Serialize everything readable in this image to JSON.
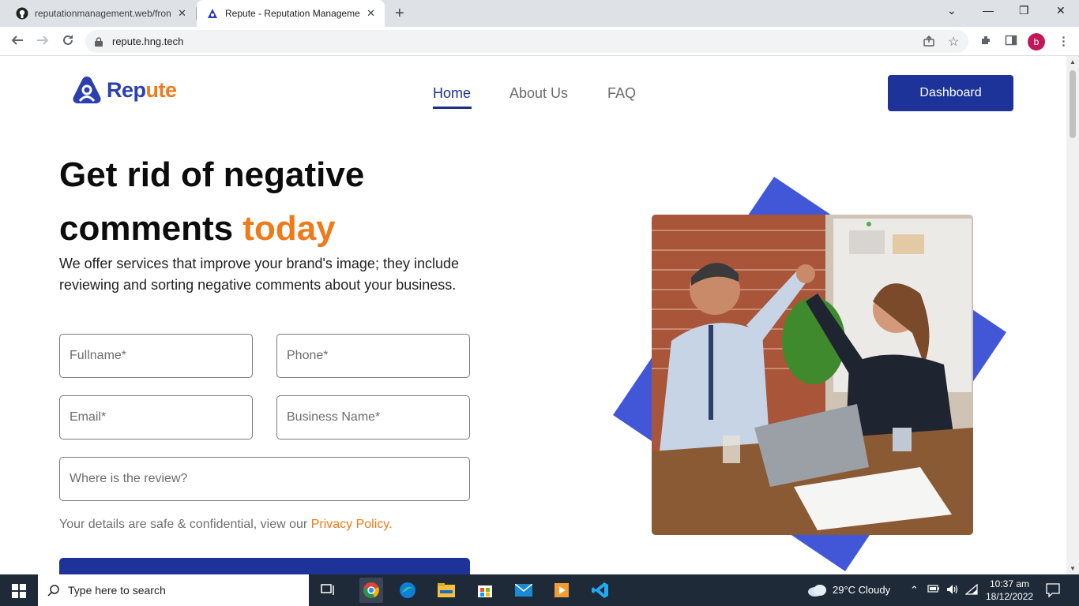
{
  "browser": {
    "tabs": [
      {
        "title": "reputationmanagement.web/fron",
        "close": "✕"
      },
      {
        "title": "Repute - Reputation Manageme",
        "close": "✕"
      }
    ],
    "new_tab": "+",
    "url": "repute.hng.tech",
    "profile_initial": "b",
    "window_controls": {
      "chevron": "⌄",
      "minimize": "—",
      "maximize": "❐",
      "close": "✕"
    }
  },
  "site": {
    "logo": {
      "part1": "Rep",
      "part2": "ute"
    },
    "nav": [
      {
        "label": "Home",
        "active": true
      },
      {
        "label": "About Us",
        "active": false
      },
      {
        "label": "FAQ",
        "active": false
      }
    ],
    "dashboard_label": "Dashboard",
    "hero": {
      "line1": "Get rid of negative",
      "line2_a": "comments ",
      "line2_b": "today",
      "subtitle": "We offer services that improve your brand's image; they include reviewing and sorting negative comments about your business."
    },
    "form": {
      "fullname": "Fullname*",
      "phone": "Phone*",
      "email": "Email*",
      "business": "Business Name*",
      "review": "Where is the review?"
    },
    "privacy": {
      "text": "Your details are safe & confidential, view our ",
      "link": "Privacy Policy."
    },
    "colors": {
      "primary": "#1d3399",
      "accent": "#ef7a1a",
      "diamond": "#4257d8"
    }
  },
  "taskbar": {
    "search_placeholder": "Type here to search",
    "weather": "29°C  Cloudy",
    "time": "10:37 am",
    "date": "18/12/2022"
  }
}
